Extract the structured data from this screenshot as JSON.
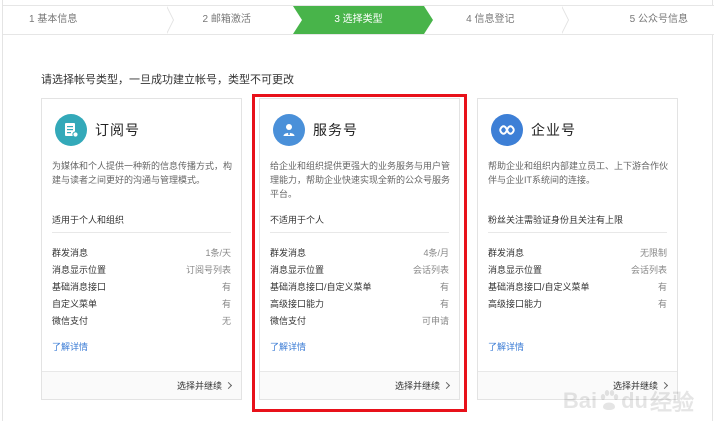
{
  "steps": [
    {
      "label": "1 基本信息",
      "active": false
    },
    {
      "label": "2 邮箱激活",
      "active": false
    },
    {
      "label": "3 选择类型",
      "active": true
    },
    {
      "label": "4 信息登记",
      "active": false
    },
    {
      "label": "5 公众号信息",
      "active": false
    }
  ],
  "intro": "请选择帐号类型，一旦成功建立帐号，类型不可更改",
  "cards": [
    {
      "name": "订阅号",
      "icon": "subscription-doc-icon",
      "icon_color": "#33a9b9",
      "desc": "为媒体和个人提供一种新的信息传播方式，构建与读者之间更好的沟通与管理模式。",
      "fit": "适用于个人和组织",
      "rows": [
        {
          "k": "群发消息",
          "v": "1条/天"
        },
        {
          "k": "消息显示位置",
          "v": "订阅号列表"
        },
        {
          "k": "基础消息接口",
          "v": "有"
        },
        {
          "k": "自定义菜单",
          "v": "有"
        },
        {
          "k": "微信支付",
          "v": "无"
        }
      ],
      "more": "了解详情",
      "action": "选择并继续"
    },
    {
      "name": "服务号",
      "icon": "service-person-icon",
      "icon_color": "#4a90d9",
      "desc": "给企业和组织提供更强大的业务服务与用户管理能力，帮助企业快速实现全新的公众号服务平台。",
      "fit": "不适用于个人",
      "rows": [
        {
          "k": "群发消息",
          "v": "4条/月"
        },
        {
          "k": "消息显示位置",
          "v": "会话列表"
        },
        {
          "k": "基础消息接口/自定义菜单",
          "v": "有"
        },
        {
          "k": "高级接口能力",
          "v": "有"
        },
        {
          "k": "微信支付",
          "v": "可申请"
        }
      ],
      "more": "了解详情",
      "action": "选择并继续"
    },
    {
      "name": "企业号",
      "icon": "enterprise-link-icon",
      "icon_color": "#3d7fd6",
      "desc": "帮助企业和组织内部建立员工、上下游合作伙伴与企业IT系统间的连接。",
      "fit": "粉丝关注需验证身份且关注有上限",
      "rows": [
        {
          "k": "群发消息",
          "v": "无限制"
        },
        {
          "k": "消息显示位置",
          "v": "会话列表"
        },
        {
          "k": "基础消息接口/自定义菜单",
          "v": "有"
        },
        {
          "k": "高级接口能力",
          "v": "有"
        }
      ],
      "more": "了解详情",
      "action": "选择并继续"
    }
  ],
  "watermark": {
    "brand": "Bai",
    "brand2": "du",
    "suffix": "经验"
  }
}
